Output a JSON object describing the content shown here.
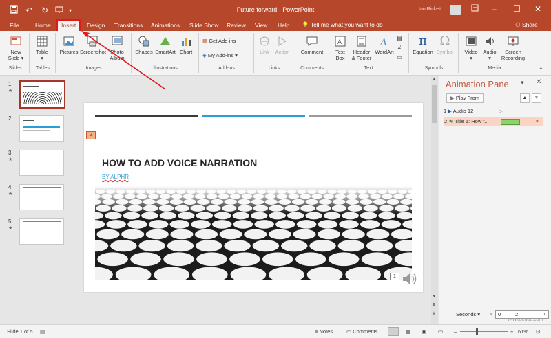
{
  "window": {
    "title": "Future forward  -  PowerPoint",
    "user_name": "Ian Rickett",
    "title_bar_color": "#b7472a"
  },
  "tabs": [
    "File",
    "Home",
    "Insert",
    "Design",
    "Transitions",
    "Animations",
    "Slide Show",
    "Review",
    "View",
    "Help"
  ],
  "active_tab": "Insert",
  "tell_me": "Tell me what you want to do",
  "share_label": "Share",
  "ribbon": {
    "groups": {
      "slides": "Slides",
      "tables": "Tables",
      "images": "Images",
      "illustrations": "Illustrations",
      "addins": "Add-ins",
      "links": "Links",
      "comments": "Comments",
      "text": "Text",
      "symbols": "Symbols",
      "media": "Media"
    },
    "buttons": {
      "new_slide_1": "New",
      "new_slide_2": "Slide",
      "table": "Table",
      "pictures": "Pictures",
      "screenshot": "Screenshot",
      "photo_1": "Photo",
      "photo_2": "Album",
      "shapes": "Shapes",
      "smartart": "SmartArt",
      "chart": "Chart",
      "get_addins": "Get Add-ins",
      "my_addins": "My Add-ins",
      "link": "Link",
      "action": "Action",
      "comment": "Comment",
      "textbox_1": "Text",
      "textbox_2": "Box",
      "header_1": "Header",
      "header_2": "& Footer",
      "wordart": "WordArt",
      "equation": "Equation",
      "symbol": "Symbol",
      "video": "Video",
      "audio": "Audio",
      "screen_rec_1": "Screen",
      "screen_rec_2": "Recording"
    }
  },
  "thumbnails": [
    {
      "num": "1",
      "star": "★"
    },
    {
      "num": "2",
      "star": ""
    },
    {
      "num": "3",
      "star": "★"
    },
    {
      "num": "4",
      "star": "★"
    },
    {
      "num": "5",
      "star": "★"
    }
  ],
  "slide": {
    "title": "HOW TO ADD VOICE NARRATION",
    "subtitle": "BY ALPHR",
    "anim_tag": "2",
    "media_tag": "1",
    "bar_colors": [
      "#3c3c3c",
      "#2a9fd6",
      "#9a9a9a"
    ]
  },
  "animation_pane": {
    "title": "Animation Pane",
    "play_from": "Play From",
    "items": [
      {
        "num": "1",
        "label": "Audio 12"
      },
      {
        "num": "2",
        "label": "Title 1: How t..."
      }
    ],
    "seconds_label": "Seconds",
    "timeline_start": "0",
    "timeline_end": "2"
  },
  "status": {
    "slide_info": "Slide 1 of 5",
    "notes": "Notes",
    "comments": "Comments",
    "zoom": "61%"
  },
  "watermark": "www.deuaq.com"
}
